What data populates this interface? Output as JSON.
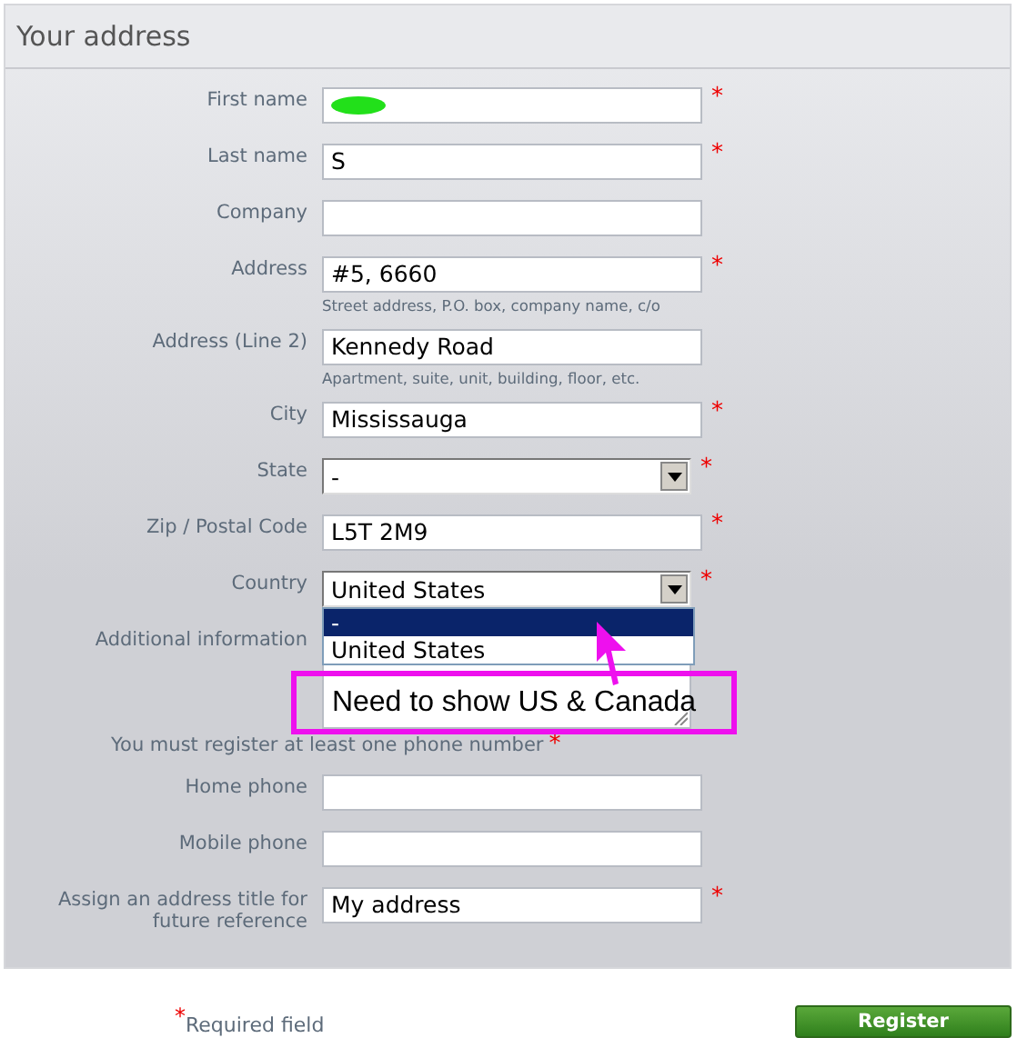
{
  "section": {
    "title": "Your address"
  },
  "fields": [
    {
      "kind": "text",
      "label": "First name",
      "redacted": true,
      "required_mark": "*"
    },
    {
      "kind": "text",
      "label": "Last name",
      "value": "S",
      "required_mark": "*"
    },
    {
      "kind": "text",
      "label": "Company"
    },
    {
      "kind": "text",
      "label": "Address",
      "value": "#5, 6660",
      "required_mark": "*",
      "hint": "Street address, P.O. box, company name, c/o"
    },
    {
      "kind": "text",
      "label": "Address (Line 2)",
      "value": "Kennedy Road",
      "hint": "Apartment, suite, unit, building, floor, etc."
    },
    {
      "kind": "text",
      "label": "City",
      "value": "Mississauga",
      "required_mark": "*"
    },
    {
      "kind": "select",
      "label": "State",
      "value": "-",
      "required_mark": "*"
    },
    {
      "kind": "text",
      "label": "Zip / Postal Code",
      "value": "L5T 2M9",
      "required_mark": "*"
    },
    {
      "kind": "select",
      "label": "Country",
      "value": "United States",
      "required_mark": "*",
      "open": true
    },
    {
      "kind": "textarea",
      "label": "Additional information"
    },
    {
      "kind": "note",
      "label": "You must register at least one phone number",
      "required_mark": "*"
    },
    {
      "kind": "text",
      "label": "Home phone"
    },
    {
      "kind": "text",
      "label": "Mobile phone"
    },
    {
      "kind": "text",
      "label": "Assign an address title for future reference",
      "value": "My address",
      "required_mark": "*"
    }
  ],
  "dropdown": {
    "options": [
      {
        "label": "-",
        "selected": true
      },
      {
        "label": "United States",
        "selected": false
      }
    ]
  },
  "annotation": {
    "text": "Need to show US & Canada"
  },
  "footer": {
    "required_mark": "*",
    "required_note": "Required field",
    "button": "Register"
  }
}
